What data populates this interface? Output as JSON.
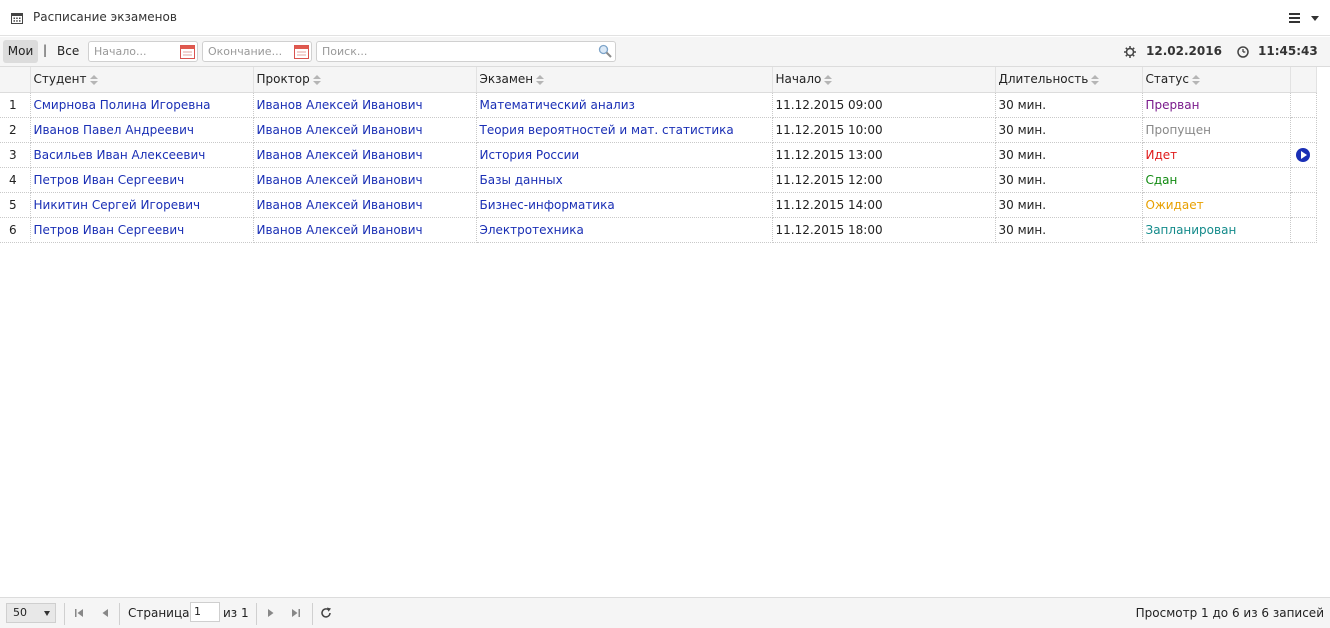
{
  "window": {
    "title": "Расписание экзаменов"
  },
  "toolbar": {
    "mine_label": "Мои",
    "separator": "|",
    "all_label": "Все",
    "start_placeholder": "Начало...",
    "end_placeholder": "Окончание...",
    "search_placeholder": "Поиск...",
    "date": "12.02.2016",
    "time": "11:45:43"
  },
  "grid": {
    "columns": [
      "Студент",
      "Проктор",
      "Экзамен",
      "Начало",
      "Длительность",
      "Статус"
    ],
    "rows": [
      {
        "num": "1",
        "student": "Смирнова Полина Игоревна",
        "proctor": "Иванов Алексей Иванович",
        "exam": "Математический анализ",
        "start": "11.12.2015 09:00",
        "duration": "30 мин.",
        "status": "Прерван",
        "status_color": "#7a1a8c",
        "play": false
      },
      {
        "num": "2",
        "student": "Иванов Павел Андреевич",
        "proctor": "Иванов Алексей Иванович",
        "exam": "Теория вероятностей и мат. статистика",
        "start": "11.12.2015 10:00",
        "duration": "30 мин.",
        "status": "Пропущен",
        "status_color": "#888888",
        "play": false
      },
      {
        "num": "3",
        "student": "Васильев Иван Алексеевич",
        "proctor": "Иванов Алексей Иванович",
        "exam": "История России",
        "start": "11.12.2015 13:00",
        "duration": "30 мин.",
        "status": "Идет",
        "status_color": "#e01b1b",
        "play": true
      },
      {
        "num": "4",
        "student": "Петров Иван Сергеевич",
        "proctor": "Иванов Алексей Иванович",
        "exam": "Базы данных",
        "start": "11.12.2015 12:00",
        "duration": "30 мин.",
        "status": "Сдан",
        "status_color": "#118a11",
        "play": false
      },
      {
        "num": "5",
        "student": "Никитин Сергей Игоревич",
        "proctor": "Иванов Алексей Иванович",
        "exam": "Бизнес-информатика",
        "start": "11.12.2015 14:00",
        "duration": "30 мин.",
        "status": "Ожидает",
        "status_color": "#e8a000",
        "play": false
      },
      {
        "num": "6",
        "student": "Петров Иван Сергеевич",
        "proctor": "Иванов Алексей Иванович",
        "exam": "Электротехника",
        "start": "11.12.2015 18:00",
        "duration": "30 мин.",
        "status": "Запланирован",
        "status_color": "#138a8a",
        "play": false
      }
    ]
  },
  "footer": {
    "page_size": "50",
    "page_label": "Страница",
    "page_value": "1",
    "of_label": "из 1",
    "records_info": "Просмотр 1 до 6 из 6 записей"
  },
  "colors": {
    "link": "#1a2fb5",
    "header_bg": "#f5f5f5"
  }
}
